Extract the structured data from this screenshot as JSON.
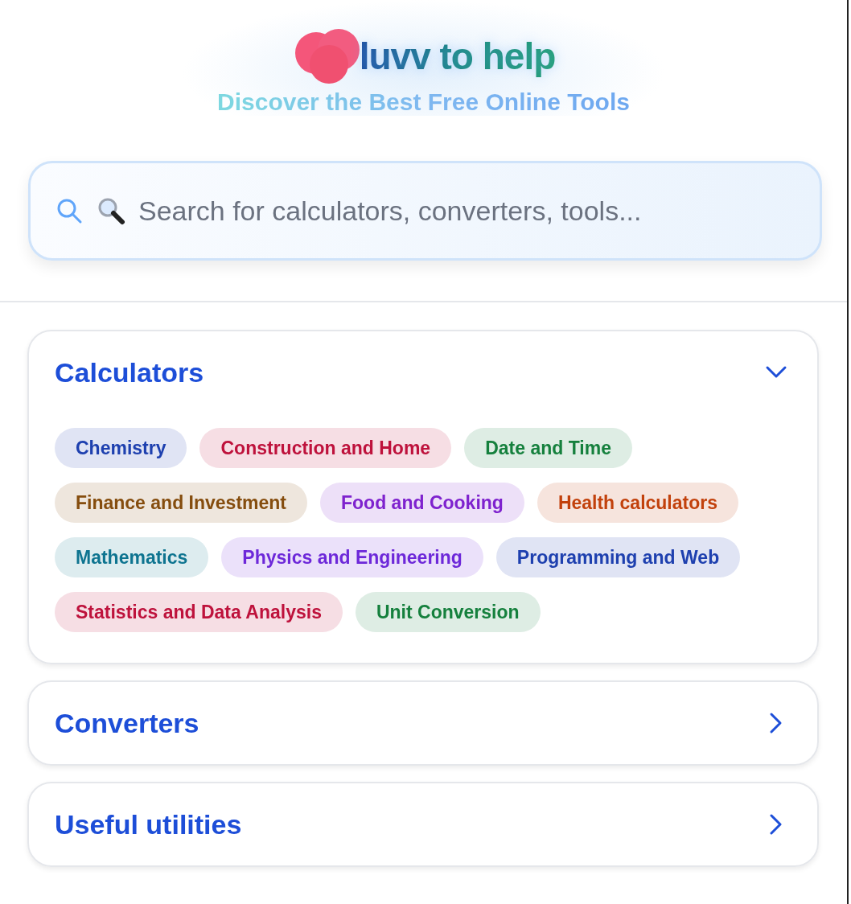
{
  "header": {
    "logo_text": "luvv to help",
    "tagline": "Discover the Best Free Online Tools"
  },
  "search": {
    "placeholder": "Search for calculators, converters, tools..."
  },
  "sections": [
    {
      "title": "Calculators",
      "expanded": true,
      "items": [
        {
          "label": "Chemistry",
          "color": "#1e40af"
        },
        {
          "label": "Construction and Home",
          "color": "#be123c"
        },
        {
          "label": "Date and Time",
          "color": "#15803d"
        },
        {
          "label": "Finance and Investment",
          "color": "#854d0e"
        },
        {
          "label": "Food and Cooking",
          "color": "#7e22ce"
        },
        {
          "label": "Health calculators",
          "color": "#c2410c"
        },
        {
          "label": "Mathematics",
          "color": "#0e7490"
        },
        {
          "label": "Physics and Engineering",
          "color": "#6d28d9"
        },
        {
          "label": "Programming and Web",
          "color": "#1e40af"
        },
        {
          "label": "Statistics and Data Analysis",
          "color": "#be123c"
        },
        {
          "label": "Unit Conversion",
          "color": "#15803d"
        }
      ]
    },
    {
      "title": "Converters",
      "expanded": false
    },
    {
      "title": "Useful utilities",
      "expanded": false
    }
  ]
}
